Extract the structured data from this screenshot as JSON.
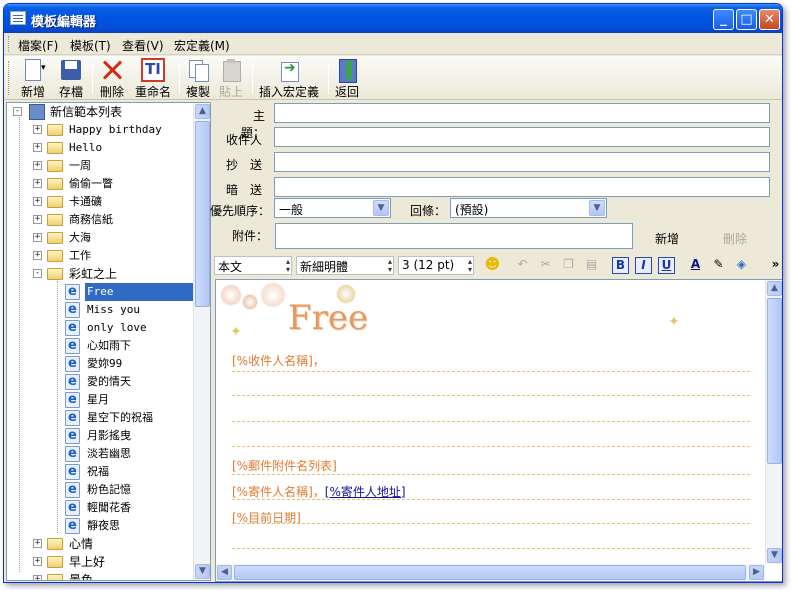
{
  "window": {
    "title": "模板編輯器",
    "min": "_",
    "max": "□",
    "close": "✕"
  },
  "menu": [
    "檔案(F)",
    "模板(T)",
    "查看(V)",
    "宏定義(M)"
  ],
  "toolbar": {
    "new": "新增",
    "save": "存檔",
    "delete": "刪除",
    "rename": "重命名",
    "copy": "複製",
    "paste": "貼上",
    "insert_macro": "插入宏定義",
    "back": "返回",
    "rename_icon_glyph": "TI"
  },
  "tree": {
    "root": "新信範本列表",
    "folders_top": [
      "Happy birthday",
      "Hello",
      "一周",
      "偷偷一瞥",
      "卡通礦",
      "商務信紙",
      "大海",
      "工作"
    ],
    "open_folder": "彩虹之上",
    "children": [
      "Free",
      "Miss you",
      "only love",
      "心如雨下",
      "愛妳99",
      "愛的情天",
      "星月",
      "星空下的祝福",
      "月影搖曳",
      "淡若幽思",
      "祝福",
      "粉色記憶",
      "輕聞花香",
      "靜夜思"
    ],
    "selected": "Free",
    "folders_bottom": [
      "心情",
      "早上好",
      "景色"
    ]
  },
  "form": {
    "subject_label": "主　題：",
    "to_label": "收件人",
    "cc_label": "抄　送",
    "bcc_label": "暗　送",
    "priority_label": "優先順序：",
    "priority_value": "一般",
    "receipt_label": "回條：",
    "receipt_value": "(預設)",
    "attachment_label": "附件：",
    "add_button": "新增",
    "remove_button": "刪除"
  },
  "format": {
    "style": "本文",
    "font": "新細明體",
    "size": "3  (12 pt)",
    "bold": "B",
    "italic": "I",
    "underline": "U",
    "font_color_glyph": "A",
    "more": "»"
  },
  "editor": {
    "banner": "Free",
    "recipient": "[%收件人名稱]，",
    "attachments": "[%郵件附件名列表]",
    "sender": "[%寄件人名稱]，",
    "sender_address": "[%寄件人地址]",
    "date": "[%目前日期]"
  },
  "colors": {
    "accent": "#316ac5",
    "title_bar": "#0054e3",
    "macro_text": "#e07a30"
  },
  "scroll_glyphs": {
    "up": "▲",
    "down": "▼",
    "left": "◀",
    "right": "▶"
  }
}
